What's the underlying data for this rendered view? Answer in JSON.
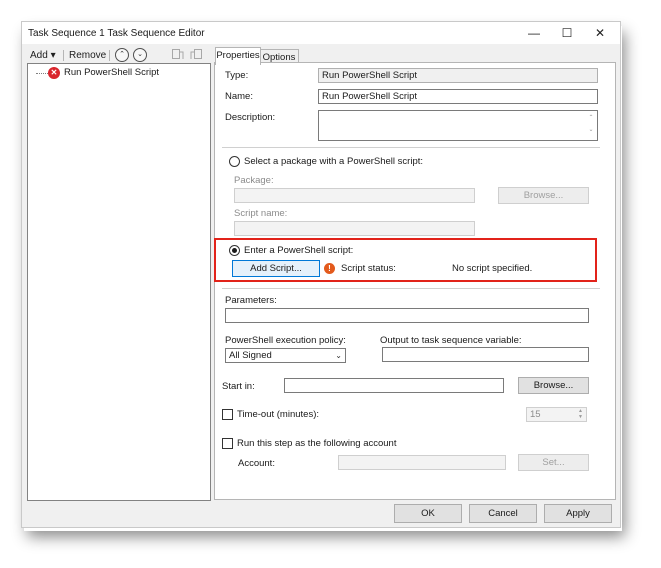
{
  "window": {
    "title": "Task Sequence 1 Task Sequence Editor",
    "minimize": "—",
    "maximize": "☐",
    "close": "✕"
  },
  "toolbar": {
    "add_label": "Add",
    "add_caret": "▾",
    "remove_label": "Remove",
    "move_up_glyph": "⌃",
    "move_down_glyph": "⌄"
  },
  "tree": {
    "items": [
      {
        "label": "Run PowerShell Script",
        "icon": "error-icon"
      }
    ],
    "error_glyph": "✕"
  },
  "tabs": [
    {
      "label": "Properties",
      "active": true
    },
    {
      "label": "Options",
      "active": false
    }
  ],
  "properties": {
    "type_label": "Type:",
    "type_value": "Run PowerShell Script",
    "name_label": "Name:",
    "name_value": "Run PowerShell Script",
    "description_label": "Description:",
    "description_value": "",
    "package_radio_label": "Select a package with a PowerShell script:",
    "package_label": "Package:",
    "package_value": "",
    "browse_package_label": "Browse...",
    "script_name_label": "Script name:",
    "script_name_value": "",
    "enter_script_radio_label": "Enter a PowerShell script:",
    "add_script_label": "Add Script...",
    "warn_glyph": "!",
    "script_status_label": "Script status:",
    "script_status_value": "No script specified.",
    "parameters_label": "Parameters:",
    "parameters_value": "",
    "execution_policy_label": "PowerShell execution policy:",
    "execution_policy_value": "All Signed",
    "output_variable_label": "Output to task sequence variable:",
    "output_variable_value": "",
    "start_in_label": "Start in:",
    "start_in_value": "",
    "browse_start_label": "Browse...",
    "timeout_label": "Time-out (minutes):",
    "timeout_value": "15",
    "run_as_label": "Run this step as the following account",
    "account_label": "Account:",
    "account_value": "",
    "set_label": "Set..."
  },
  "footer": {
    "ok_label": "OK",
    "cancel_label": "Cancel",
    "apply_label": "Apply"
  },
  "colors": {
    "highlight_border": "#e2231a",
    "error_icon": "#d9252c",
    "warning_icon": "#e35a1c"
  }
}
